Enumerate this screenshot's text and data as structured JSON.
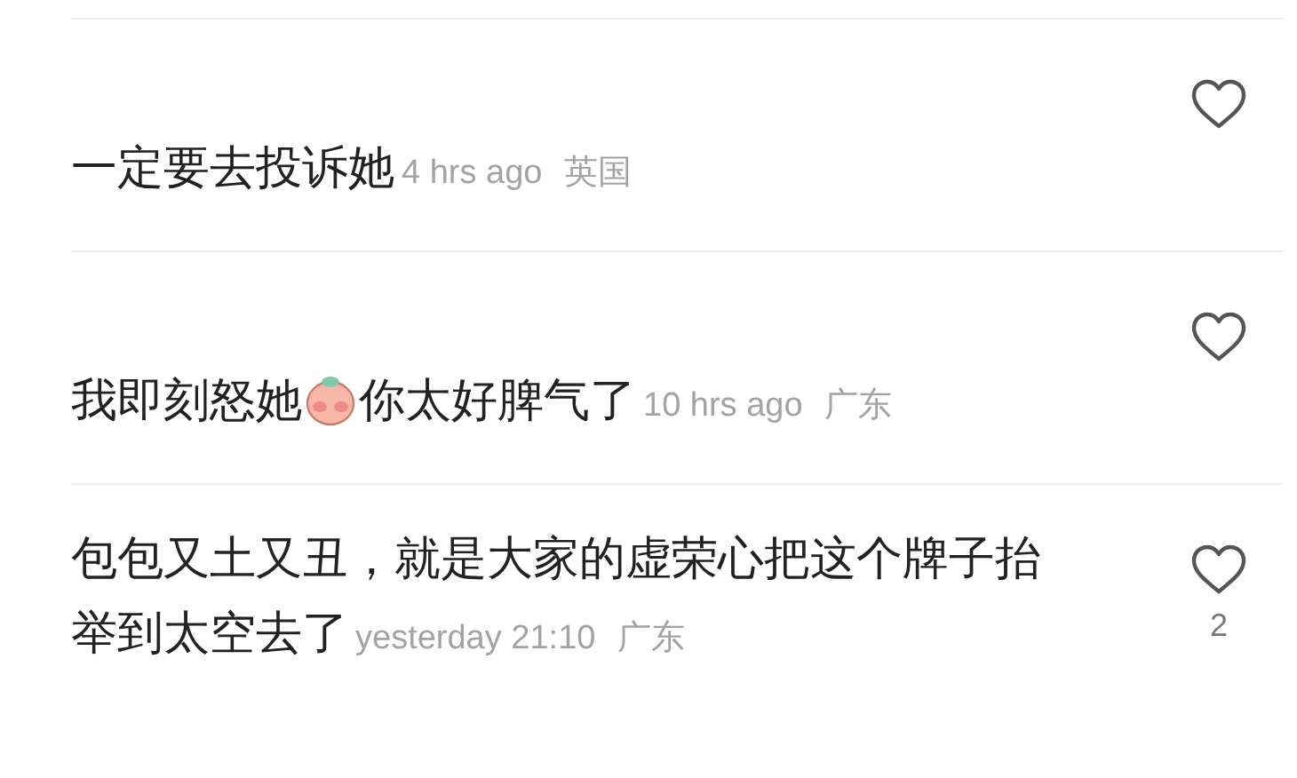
{
  "comments": [
    {
      "segments": [
        {
          "kind": "text",
          "text": "一定要去投诉她"
        }
      ],
      "time": "4 hrs ago",
      "location": "英国",
      "liked": false
    },
    {
      "segments": [
        {
          "kind": "text",
          "text": "我即刻怒她"
        },
        {
          "kind": "sticker"
        },
        {
          "kind": "text",
          "text": "你太好脾气了"
        }
      ],
      "time": "10 hrs ago",
      "location": "广东",
      "liked": false
    },
    {
      "segments": [
        {
          "kind": "text",
          "text": "包包又土又丑，就是大家的虚荣心把这个牌子抬举到太空去了"
        }
      ],
      "time": "yesterday 21:10",
      "location": "广东",
      "liked": false,
      "like_count": "2"
    }
  ]
}
